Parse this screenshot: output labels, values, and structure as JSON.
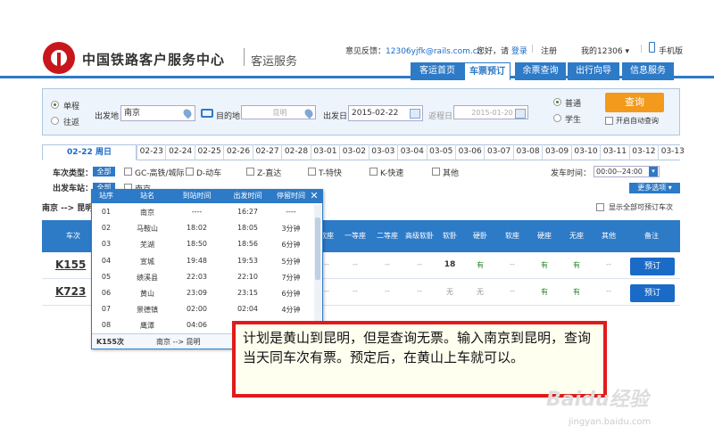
{
  "header": {
    "brand": "中国铁路客户服务中心",
    "sub": "客运服务",
    "feedback_label": "意见反馈：",
    "feedback_email": "12306yjfk@rails.com.cn",
    "greeting": "您好，请",
    "login": "登录",
    "register": "注册",
    "my12306": "我的12306",
    "mobile": "手机版"
  },
  "nav": [
    "客运首页",
    "车票预订",
    "余票查询",
    "出行向导",
    "信息服务"
  ],
  "search": {
    "one_way": "单程",
    "round_trip": "往返",
    "from_label": "出发地",
    "from_value": "南京",
    "to_label": "目的地",
    "to_value": "昆明",
    "date_label": "出发日",
    "date_value": "2015-02-22",
    "return_label": "返程日",
    "return_value": "2015-01-20",
    "normal": "普通",
    "student": "学生",
    "query": "查询",
    "auto_query": "开启自动查询"
  },
  "dates": [
    "02-22 周日",
    "02-23",
    "02-24",
    "02-25",
    "02-26",
    "02-27",
    "02-28",
    "03-01",
    "03-02",
    "03-03",
    "03-04",
    "03-05",
    "03-06",
    "03-07",
    "03-08",
    "03-09",
    "03-10",
    "03-11",
    "03-12",
    "03-13"
  ],
  "filters": {
    "type_label": "车次类型：",
    "all": "全部",
    "types": [
      "GC-高铁/城际",
      "D-动车",
      "Z-直达",
      "T-特快",
      "K-快速",
      "其他"
    ],
    "station_label": "出发车站：",
    "station_all": "全部",
    "station": "南京",
    "depart_time_label": "发车时间：",
    "depart_time": "00:00--24:00",
    "more": "更多选项"
  },
  "results": {
    "route": "南京 --> 昆明",
    "show_all": "显示全部可预订车次",
    "headers": {
      "train": "车次",
      "soft_sleep_plus": "软座",
      "first": "一等座",
      "second": "二等座",
      "hi_soft": "高级软卧",
      "soft_sleep": "软卧",
      "hard_sleep": "硬卧",
      "soft_seat": "软座",
      "hard_seat": "硬座",
      "no_seat": "无座",
      "other": "其他",
      "note": "备注"
    },
    "rows": [
      {
        "train": "K155",
        "cells": [
          "--",
          "--",
          "--",
          "--",
          "18",
          "有",
          "--",
          "有",
          "有",
          "--"
        ],
        "book": "预订"
      },
      {
        "train": "K723",
        "cells": [
          "--",
          "--",
          "--",
          "--",
          "无",
          "无",
          "--",
          "有",
          "有",
          "--"
        ],
        "book": "预订"
      }
    ]
  },
  "popup": {
    "headers": [
      "站序",
      "站名",
      "到站时间",
      "出发时间",
      "停留时间"
    ],
    "rows": [
      [
        "01",
        "南京",
        "----",
        "16:27",
        "----"
      ],
      [
        "02",
        "马鞍山",
        "18:02",
        "18:05",
        "3分钟"
      ],
      [
        "03",
        "芜湖",
        "18:50",
        "18:56",
        "6分钟"
      ],
      [
        "04",
        "宣城",
        "19:48",
        "19:53",
        "5分钟"
      ],
      [
        "05",
        "绩溪县",
        "22:03",
        "22:10",
        "7分钟"
      ],
      [
        "06",
        "黄山",
        "23:09",
        "23:15",
        "6分钟"
      ],
      [
        "07",
        "景德镇",
        "02:00",
        "02:04",
        "4分钟"
      ],
      [
        "08",
        "鹰潭",
        "04:06",
        "",
        ""
      ]
    ],
    "footer_train": "K155次",
    "footer_route": "南京 --> 昆明"
  },
  "annotation": "计划是黄山到昆明，但是查询无票。输入南京到昆明，查询当天同车次有票。预定后，在黄山上车就可以。",
  "watermark": "Baidu经验",
  "watermark_url": "jingyan.baidu.com",
  "colors": {
    "brand_red": "#c8161d",
    "accent_blue": "#2d7ac7",
    "query_orange": "#f39a1c",
    "highlight_red": "#e11b1b"
  }
}
